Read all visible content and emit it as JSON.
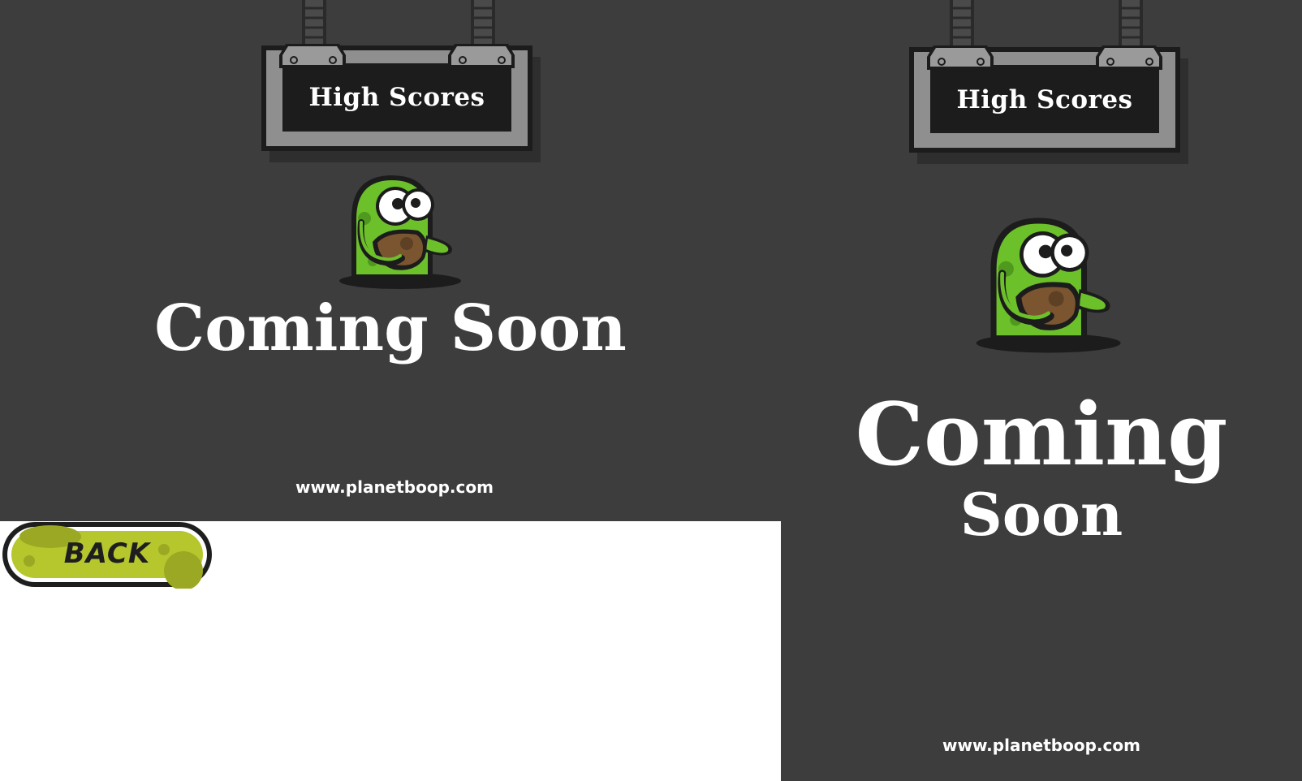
{
  "screens": [
    {
      "sign_label": "High Scores",
      "coming_line1": "Coming Soon",
      "coming_line2": "",
      "url": "www.planetboop.com"
    },
    {
      "sign_label": "High Scores",
      "coming_line1": "Coming",
      "coming_line2": "Soon",
      "url": "www.planetboop.com"
    }
  ],
  "back_button": {
    "label": "BACK"
  },
  "icons": {
    "mascot": "green-alien-mascot-icon",
    "sign": "hanging-sign-icon"
  },
  "colors": {
    "background": "#3d3d3d",
    "sign_frame": "#8f8f8f",
    "sign_plate": "#1c1c1c",
    "mascot_green": "#6cc02a",
    "button_green": "#b5c72c"
  }
}
